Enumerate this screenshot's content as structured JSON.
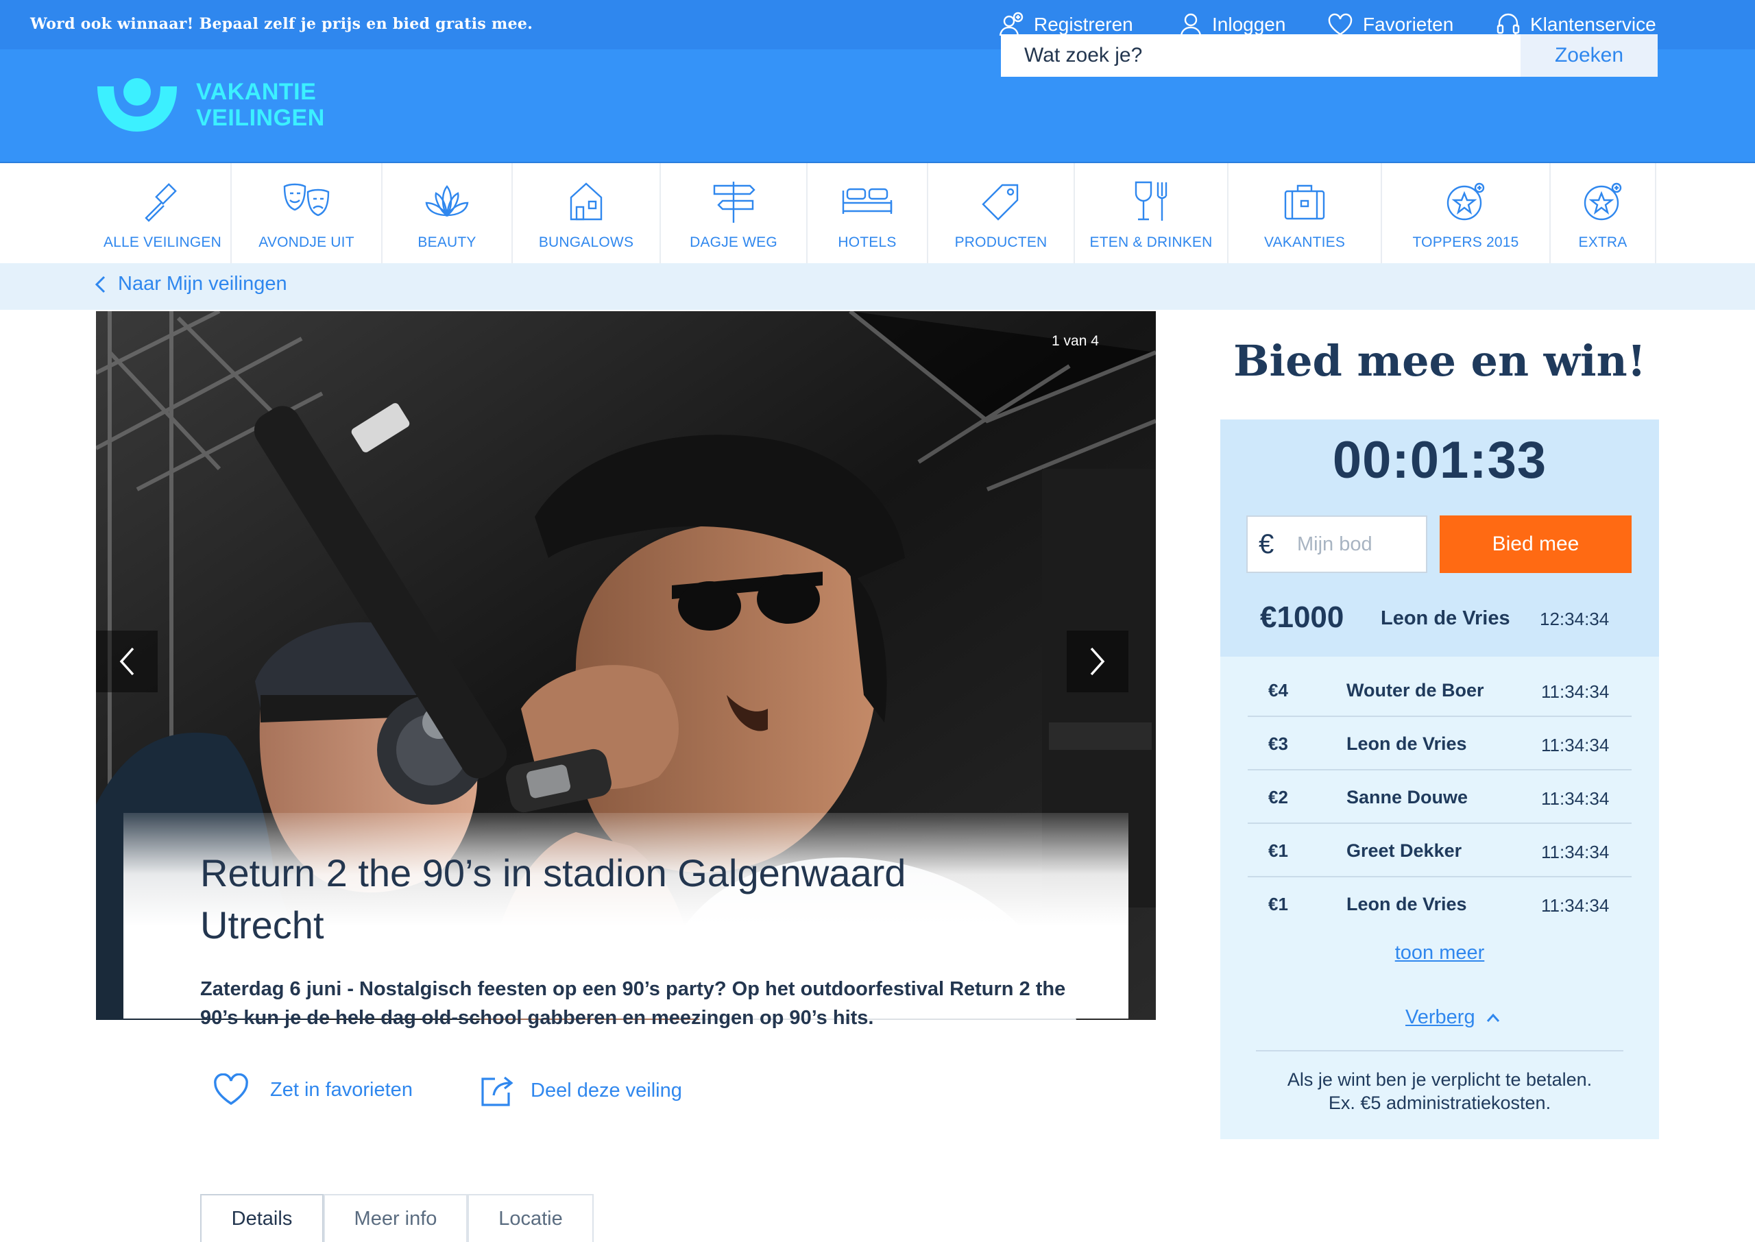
{
  "topbar": {
    "promo": "Word ook winnaar! Bepaal zelf je prijs en bied gratis mee.",
    "links": [
      {
        "label": "Registreren",
        "icon": "user-add-icon"
      },
      {
        "label": "Inloggen",
        "icon": "user-icon"
      },
      {
        "label": "Favorieten",
        "icon": "heart-icon"
      },
      {
        "label": "Klantenservice",
        "icon": "headset-icon"
      }
    ]
  },
  "header": {
    "logo_line1": "VAKANTIE",
    "logo_line2": "VEILINGEN",
    "search_placeholder": "Wat zoek je?",
    "search_button": "Zoeken"
  },
  "categories": [
    {
      "label": "ALLE VEILINGEN",
      "icon": "gavel-icon"
    },
    {
      "label": "AVONDJE UIT",
      "icon": "theater-masks-icon"
    },
    {
      "label": "BEAUTY",
      "icon": "lotus-icon"
    },
    {
      "label": "BUNGALOWS",
      "icon": "house-icon"
    },
    {
      "label": "DAGJE WEG",
      "icon": "signpost-icon"
    },
    {
      "label": "HOTELS",
      "icon": "bed-icon"
    },
    {
      "label": "PRODUCTEN",
      "icon": "tag-icon"
    },
    {
      "label": "ETEN & DRINKEN",
      "icon": "glass-fork-icon"
    },
    {
      "label": "VAKANTIES",
      "icon": "suitcase-icon"
    },
    {
      "label": "TOPPERS 2015",
      "icon": "star-badge-icon"
    },
    {
      "label": "EXTRA",
      "icon": "star-badge-icon"
    }
  ],
  "breadcrumb": {
    "label": "Naar Mijn veilingen"
  },
  "gallery": {
    "counter": "1 van 4"
  },
  "auction": {
    "title": "Return 2 the 90’s in stadion Galgenwaard Utrecht",
    "description": "Zaterdag 6 juni - Nostalgisch feesten op een 90’s party? Op het outdoorfestival Return 2 the 90’s kun je de hele dag old-school gabberen en meezingen op 90’s hits."
  },
  "actions": {
    "favorite": "Zet in favorieten",
    "share": "Deel deze veiling"
  },
  "tabs": [
    {
      "label": "Details",
      "active": true
    },
    {
      "label": "Meer info",
      "active": false
    },
    {
      "label": "Locatie",
      "active": false
    }
  ],
  "bidpanel": {
    "title": "Bied mee en win!",
    "timer": "00:01:33",
    "currency_symbol": "€",
    "bid_placeholder": "Mijn bod",
    "bid_button": "Bied mee",
    "leading": {
      "amount": "€1000",
      "name": "Leon de Vries",
      "time": "12:34:34"
    },
    "history": [
      {
        "amount": "€4",
        "name": "Wouter de Boer",
        "time": "11:34:34"
      },
      {
        "amount": "€3",
        "name": "Leon de Vries",
        "time": "11:34:34"
      },
      {
        "amount": "€2",
        "name": "Sanne Douwe",
        "time": "11:34:34"
      },
      {
        "amount": "€1",
        "name": "Greet Dekker",
        "time": "11:34:34"
      },
      {
        "amount": "€1",
        "name": "Leon de Vries",
        "time": "11:34:34"
      }
    ],
    "show_more": "toon meer",
    "hide": "Verberg",
    "notice_line1": "Als je wint ben je verplicht te betalen.",
    "notice_line2": "Ex. €5 administratiekosten."
  },
  "colors": {
    "topbar": "#2f87ee",
    "header": "#3593f8",
    "logo": "#3cf0ff",
    "accent": "#2f87ee",
    "bid_button": "#ff6a13",
    "navy_text": "#1f3a5c"
  }
}
